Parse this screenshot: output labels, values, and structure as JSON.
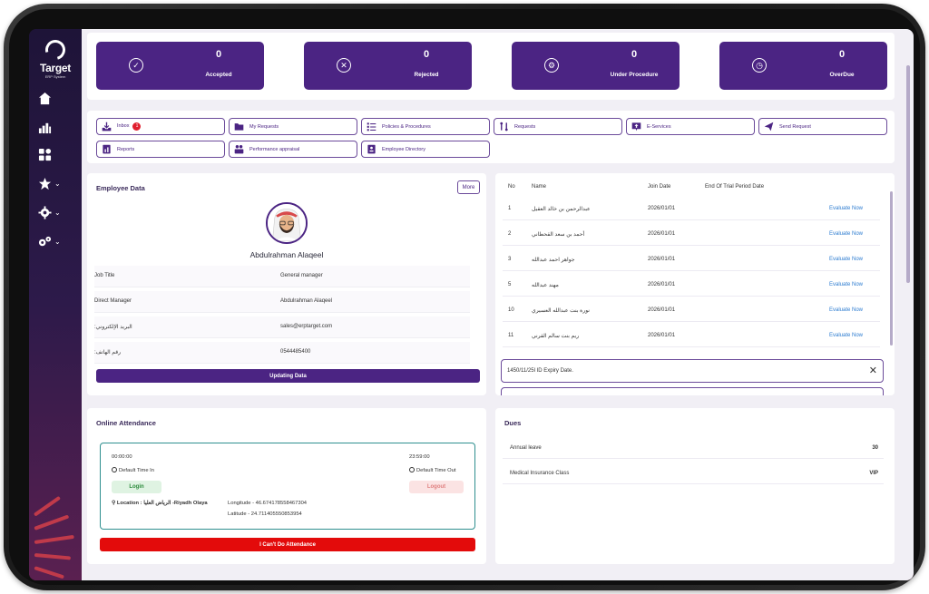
{
  "brand": {
    "name": "Target",
    "sub": "ERP System"
  },
  "sidebar": {
    "items": [
      {
        "icon": "home-icon"
      },
      {
        "icon": "chart-icon"
      },
      {
        "icon": "apps-icon"
      },
      {
        "icon": "star-icon",
        "chevron": "⌄"
      },
      {
        "icon": "gear-icon",
        "chevron": "⌄"
      },
      {
        "icon": "gears-icon",
        "chevron": "⌄"
      }
    ]
  },
  "stats": [
    {
      "label": "Accepted",
      "count": "0",
      "icon": "check-circle-icon",
      "glyph": "✓"
    },
    {
      "label": "Rejected",
      "count": "0",
      "icon": "x-circle-icon",
      "glyph": "✕"
    },
    {
      "label": "Under Procedure",
      "count": "0",
      "icon": "gear-icon",
      "glyph": "⚙"
    },
    {
      "label": "OverDue",
      "count": "0",
      "icon": "timer-icon",
      "glyph": "◷"
    }
  ],
  "quick_links": [
    {
      "label": "Inbox",
      "badge": "1",
      "icon": "inbox-icon"
    },
    {
      "label": "My Requests",
      "icon": "folder-icon"
    },
    {
      "label": "Policies & Procedures",
      "icon": "checklist-icon"
    },
    {
      "label": "Requests",
      "icon": "flow-icon"
    },
    {
      "label": "E-Services",
      "icon": "upload-icon"
    },
    {
      "label": "Send Request",
      "icon": "send-icon"
    },
    {
      "label": "Reports",
      "icon": "report-icon"
    },
    {
      "label": "Performance appraisal",
      "icon": "team-icon"
    },
    {
      "label": "Employee Directory",
      "icon": "directory-icon"
    }
  ],
  "employee": {
    "section_title": "Employee Data",
    "more_label": "More",
    "name": "Abdulrahman Alaqeel",
    "rows": [
      {
        "key": "Job Title",
        "value": "General manager"
      },
      {
        "key": "Direct Manager",
        "value": "Abdulrahman Alaqeel"
      },
      {
        "key": ":البريد الإلكتروني",
        "value": "sales@erptarget.com"
      },
      {
        "key": ":رقم الهاتف",
        "value": "0544485400"
      }
    ],
    "update_label": "Updating Data"
  },
  "trial_table": {
    "headers": [
      "No",
      "Name",
      "Join Date",
      "End Of Trial Period Date"
    ],
    "rows": [
      {
        "no": "1",
        "name": "عبدالرحمن بن خالد العقيل",
        "join": "2026/01/01",
        "action": "Evaluate Now"
      },
      {
        "no": "2",
        "name": "أحمد بن سعد القحطاني",
        "join": "2026/01/01",
        "action": "Evaluate Now"
      },
      {
        "no": "3",
        "name": "جواهر احمد عبدالله",
        "join": "2026/01/01",
        "action": "Evaluate Now"
      },
      {
        "no": "5",
        "name": "مهند عبدالله",
        "join": "2026/01/01",
        "action": "Evaluate Now"
      },
      {
        "no": "10",
        "name": "نورة بنت عبدالله العسيري",
        "join": "2026/01/01",
        "action": "Evaluate Now"
      },
      {
        "no": "11",
        "name": "ريم بنت سالم القرني",
        "join": "2026/01/01",
        "action": "Evaluate Now"
      }
    ],
    "expiry_text": "1450/11/25l ID Expiry Date.",
    "close_glyph": "✕"
  },
  "attendance": {
    "title": "Online Attendance",
    "time_in": "00:00:00",
    "time_in_label": "Default Time In",
    "time_out": "23:59:00",
    "time_out_label": "Default Time Out",
    "login_label": "Login",
    "logout_label": "Logout",
    "location_label": "Location : الرياض العليا -Riyadh Olaya",
    "longitude": "Longitude - 46.674178558467304",
    "latitude": "Latitude - 24.711405550853954",
    "cant_label": "I Can't Do Attendance"
  },
  "dues": {
    "title": "Dues",
    "rows": [
      {
        "key": "Annual leave",
        "value": "30"
      },
      {
        "key": "Medical Insurance Class",
        "value": "VIP"
      }
    ]
  },
  "colors": {
    "primary": "#4b2483",
    "danger": "#e30b0b",
    "link": "#2d7cd0",
    "success_bg": "#dff3e2"
  }
}
